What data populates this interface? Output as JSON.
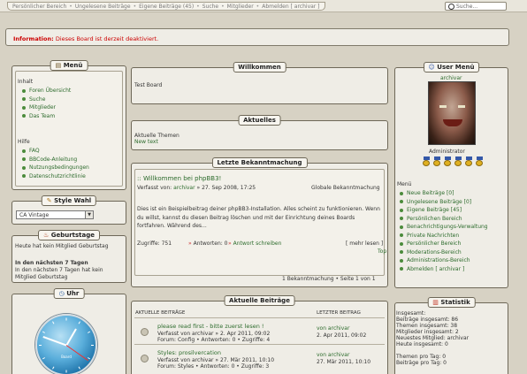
{
  "topnav": {
    "items": [
      "Persönlicher Bereich",
      "Ungelesene Beiträge",
      "Eigene Beiträge (45)",
      "Suche",
      "Mitglieder",
      "Abmelden [ archivar ]"
    ],
    "search_placeholder": "Suche..."
  },
  "info": {
    "label": "Information:",
    "message": "Dieses Board ist derzeit deaktiviert."
  },
  "menu": {
    "title": "Menü",
    "inhalt_heading": "Inhalt",
    "inhalt_items": [
      "Foren Übersicht",
      "Suche",
      "Mitglieder",
      "Das Team"
    ],
    "hilfe_heading": "Hilfe",
    "hilfe_items": [
      "FAQ",
      "BBCode-Anleitung",
      "Nutzungsbedingungen",
      "Datenschutzrichtlinie"
    ]
  },
  "style": {
    "title": "Style Wahl",
    "selected": "CA Vintage"
  },
  "birthdays": {
    "title": "Geburtstage",
    "today": "Heute hat kein Mitglied Geburtstag",
    "next_heading": "In den nächsten 7 Tagen",
    "next": "In den nächsten 7 Tagen hat kein Mitglied Geburtstag"
  },
  "clock": {
    "title": "Uhr",
    "brand": "Board"
  },
  "welcome": {
    "title": "Willkommen",
    "text": "Test Board"
  },
  "current": {
    "title": "Aktuelles",
    "heading": "Aktuelle Themen",
    "text": "New text"
  },
  "announcement": {
    "title": "Letzte Bekanntmachung",
    "post_title": ":: Willkommen bei phpBB3!",
    "meta_prefix": "Verfasst von:",
    "author": "archivar",
    "meta_date": "» 27. Sep 2008, 17:25",
    "scope": "Globale Bekanntmachung",
    "body": "Dies ist ein Beispielbeitrag deiner phpBB3-Installation. Alles scheint zu funktionieren. Wenn du willst, kannst du diesen Beitrag löschen und mit der Einrichtung deines Boards fortfahren. Während des...",
    "views": "Zugriffe: 751",
    "replies": "Antworten: 0",
    "reply_link": "Antwort schreiben",
    "read_more": "[ mehr lesen ]",
    "top": "Top",
    "pagination": "1 Bekanntmachung • Seite 1 von 1"
  },
  "recent": {
    "title": "Aktuelle Beiträge",
    "col_topic": "AKTUELLE BEITRÄGE",
    "col_last": "LETZTER BEITRAG",
    "rows": [
      {
        "title": "please read first - bitte zuerst lesen !",
        "meta": "Verfasst von archivar » 2. Apr 2011, 09:02",
        "forum": "Forum: Config • Antworten: 0 • Zugriffe: 4",
        "last_user": "von archivar",
        "last_date": "2. Apr 2011, 09:02"
      },
      {
        "title": "Styles: prosilvercation",
        "meta": "Verfasst von archivar » 27. Mär 2011, 10:10",
        "forum": "Forum: Styles • Antworten: 0 • Zugriffe: 3",
        "last_user": "von archivar",
        "last_date": "27. Mär 2011, 10:10"
      }
    ]
  },
  "usermenu": {
    "title": "User Menü",
    "username": "archivar",
    "rank": "Administrator",
    "heading": "Menü",
    "items": [
      "Neue Beiträge [0]",
      "Ungelesene Beiträge [0]",
      "Eigene Beiträge [45]",
      "Persönlichen Bereich",
      "Benachrichtigungs-Verwaltung",
      "Private Nachrichten",
      "Persönlicher Bereich",
      "Moderations-Bereich",
      "Administrations-Bereich",
      "Abmelden [ archivar ]"
    ]
  },
  "stats": {
    "title": "Statistik",
    "lines": [
      "Insgesamt:",
      "Beiträge insgesamt: 86",
      "Themen insgesamt: 38",
      "Mitglieder insgesamt: 2",
      "Neuestes Mitglied: archivar",
      "Heute insgesamt: 0",
      "",
      "Themen pro Tag: 0",
      "Beiträge pro Tag: 0"
    ]
  }
}
